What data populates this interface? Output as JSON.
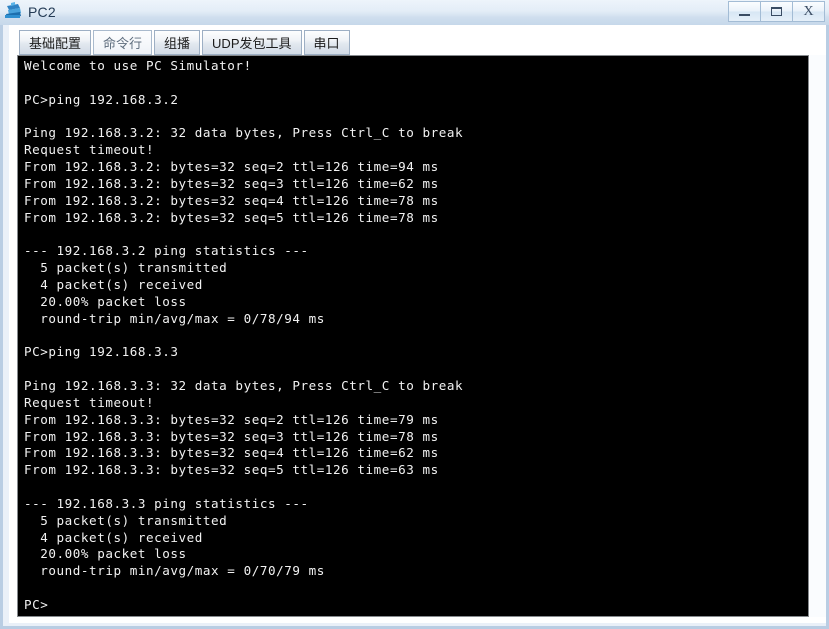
{
  "window": {
    "title": "PC2",
    "icon": "pc-device-icon",
    "controls": [
      {
        "name": "minimize-button",
        "icon": "minimize-icon",
        "label": "—"
      },
      {
        "name": "maximize-button",
        "icon": "maximize-icon",
        "label": "□"
      },
      {
        "name": "close-button",
        "icon": "close-icon",
        "label": "X"
      }
    ]
  },
  "tabs": [
    {
      "label": "基础配置",
      "active": false
    },
    {
      "label": "命令行",
      "active": true
    },
    {
      "label": "组播",
      "active": false
    },
    {
      "label": "UDP发包工具",
      "active": false
    },
    {
      "label": "串口",
      "active": false
    }
  ],
  "terminal": {
    "background_color": "#000000",
    "text_color": "#f2f2f2",
    "content": "Welcome to use PC Simulator!\n\nPC>ping 192.168.3.2\n\nPing 192.168.3.2: 32 data bytes, Press Ctrl_C to break\nRequest timeout!\nFrom 192.168.3.2: bytes=32 seq=2 ttl=126 time=94 ms\nFrom 192.168.3.2: bytes=32 seq=3 ttl=126 time=62 ms\nFrom 192.168.3.2: bytes=32 seq=4 ttl=126 time=78 ms\nFrom 192.168.3.2: bytes=32 seq=5 ttl=126 time=78 ms\n\n--- 192.168.3.2 ping statistics ---\n  5 packet(s) transmitted\n  4 packet(s) received\n  20.00% packet loss\n  round-trip min/avg/max = 0/78/94 ms\n\nPC>ping 192.168.3.3\n\nPing 192.168.3.3: 32 data bytes, Press Ctrl_C to break\nRequest timeout!\nFrom 192.168.3.3: bytes=32 seq=2 ttl=126 time=79 ms\nFrom 192.168.3.3: bytes=32 seq=3 ttl=126 time=78 ms\nFrom 192.168.3.3: bytes=32 seq=4 ttl=126 time=62 ms\nFrom 192.168.3.3: bytes=32 seq=5 ttl=126 time=63 ms\n\n--- 192.168.3.3 ping statistics ---\n  5 packet(s) transmitted\n  4 packet(s) received\n  20.00% packet loss\n  round-trip min/avg/max = 0/70/79 ms\n\nPC>"
  }
}
